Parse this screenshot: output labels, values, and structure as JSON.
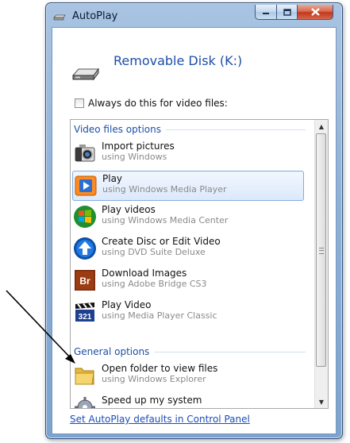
{
  "window": {
    "title": "AutoPlay",
    "minimize_icon": "minimize-icon",
    "maximize_icon": "maximize-icon",
    "close_icon": "close-icon"
  },
  "header": {
    "drive_name": "Removable Disk (K:)",
    "drive_icon": "removable-drive-icon"
  },
  "always_checkbox": {
    "label": "Always do this for video files:",
    "checked": false
  },
  "groups": {
    "video": "Video files options",
    "general": "General options"
  },
  "items": [
    {
      "label": "Import pictures",
      "sub": "using Windows",
      "icon": "camera-icon"
    },
    {
      "label": "Play",
      "sub": "using Windows Media Player",
      "icon": "media-player-icon",
      "selected": true
    },
    {
      "label": "Play videos",
      "sub": "using Windows Media Center",
      "icon": "windows-flag-icon"
    },
    {
      "label": "Create Disc or Edit Video",
      "sub": "using DVD Suite Deluxe",
      "icon": "dvd-suite-icon"
    },
    {
      "label": "Download Images",
      "sub": "using Adobe Bridge CS3",
      "icon": "adobe-bridge-icon",
      "badge": "Br"
    },
    {
      "label": "Play Video",
      "sub": "using Media Player Classic",
      "icon": "media-player-classic-icon",
      "badge": "321"
    },
    {
      "label": "Open folder to view files",
      "sub": "using Windows Explorer",
      "icon": "folder-icon"
    },
    {
      "label": "Speed up my system",
      "sub": "",
      "icon": "gear-icon"
    }
  ],
  "footer": {
    "link": "Set AutoPlay defaults in Control Panel"
  },
  "colors": {
    "link": "#1a4dba",
    "group_header": "#1c4ea6",
    "selection": "#dbe9fb"
  }
}
